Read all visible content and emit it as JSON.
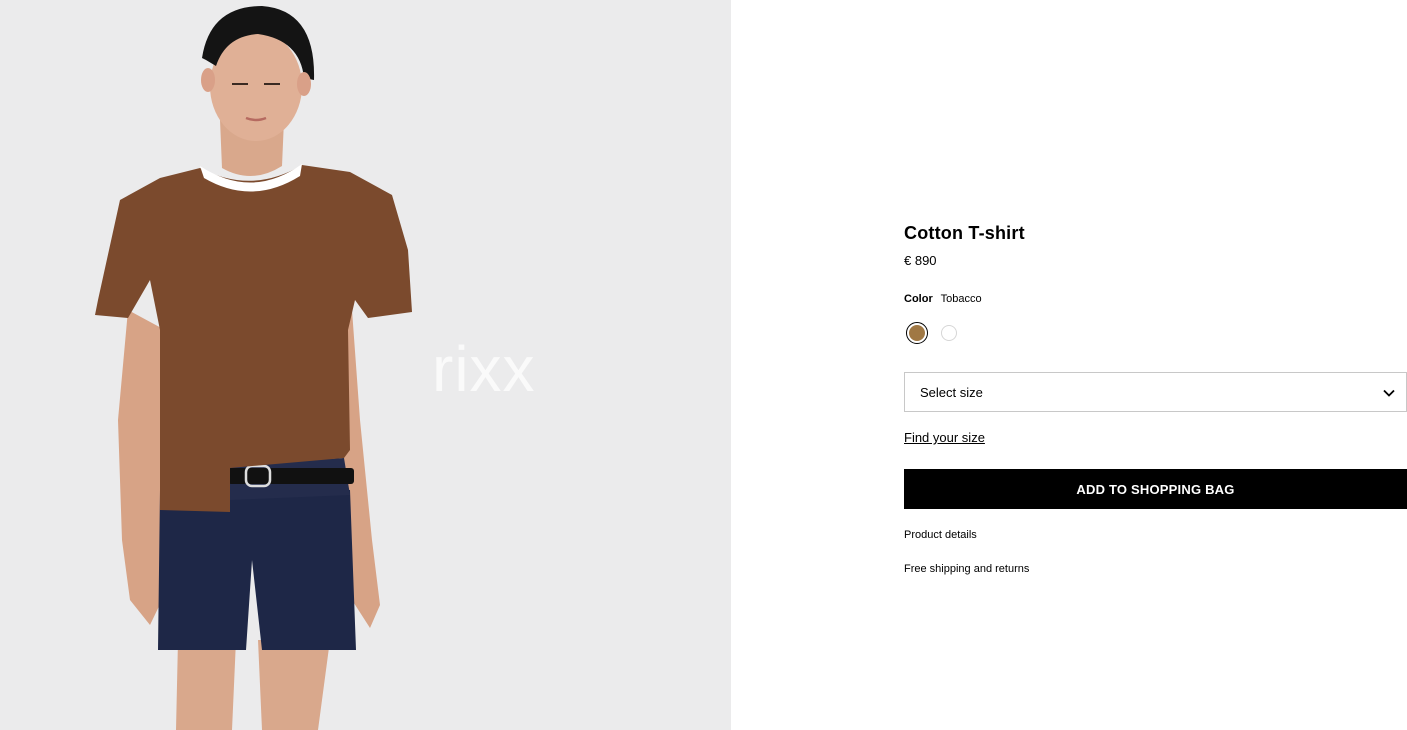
{
  "product_image": {
    "alt": "Model wearing tobacco cotton t-shirt and navy shorts",
    "watermark": "rixx"
  },
  "product": {
    "title": "Cotton T-shirt",
    "price": "€ 890"
  },
  "color": {
    "label": "Color",
    "selected_name": "Tobacco",
    "swatches": [
      {
        "name": "Tobacco",
        "hex": "#a07844",
        "selected": true
      },
      {
        "name": "White",
        "hex": "#ffffff",
        "selected": false
      }
    ]
  },
  "size": {
    "placeholder": "Select size"
  },
  "links": {
    "find_size": "Find your size",
    "product_details": "Product details",
    "shipping": "Free shipping and returns"
  },
  "actions": {
    "add_to_bag": "ADD TO SHOPPING BAG"
  },
  "colors": {
    "image_bg": "#ebebec",
    "button_bg": "#000000",
    "button_text": "#ffffff"
  }
}
